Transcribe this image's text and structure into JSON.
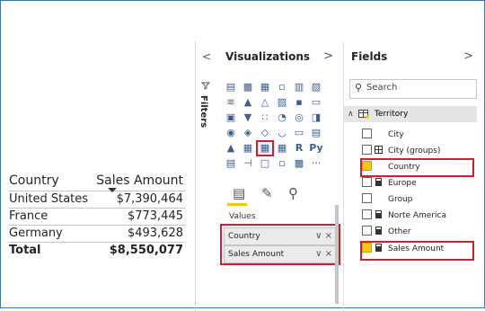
{
  "table_visual": {
    "col_country": "Country",
    "col_sales": "Sales Amount",
    "rows": [
      {
        "country": "United States",
        "sales": "$7,390,464"
      },
      {
        "country": "France",
        "sales": "$773,445"
      },
      {
        "country": "Germany",
        "sales": "$493,628"
      }
    ],
    "total_label": "Total",
    "total_value": "$8,550,077"
  },
  "collapse": {
    "chev": "<",
    "filters_label": "Filters"
  },
  "visualizations": {
    "title": "Visualizations",
    "chev": ">",
    "values_label": "Values",
    "r_label": "R",
    "py_label": "Py",
    "more_label": "···",
    "wells": [
      {
        "label": "Country",
        "controls": "∨ ×"
      },
      {
        "label": "Sales Amount",
        "controls": "∨ ×"
      }
    ]
  },
  "fields": {
    "title": "Fields",
    "chev": ">",
    "search_placeholder": "Search",
    "table_name": "Territory",
    "items": [
      {
        "label": "City",
        "checked": false,
        "icon": "none"
      },
      {
        "label": "City (groups)",
        "checked": false,
        "icon": "group-icon"
      },
      {
        "label": "Country",
        "checked": true,
        "icon": "none"
      },
      {
        "label": "Europe",
        "checked": false,
        "icon": "calc-icon"
      },
      {
        "label": "Group",
        "checked": false,
        "icon": "none"
      },
      {
        "label": "Norte America",
        "checked": false,
        "icon": "calc-icon"
      },
      {
        "label": "Other",
        "checked": false,
        "icon": "calc-icon"
      },
      {
        "label": "Sales Amount",
        "checked": true,
        "icon": "calc-icon"
      }
    ]
  },
  "colors": {
    "accent": "#f2c811",
    "highlight": "#d21e2e",
    "frame": "#3b76b6"
  }
}
